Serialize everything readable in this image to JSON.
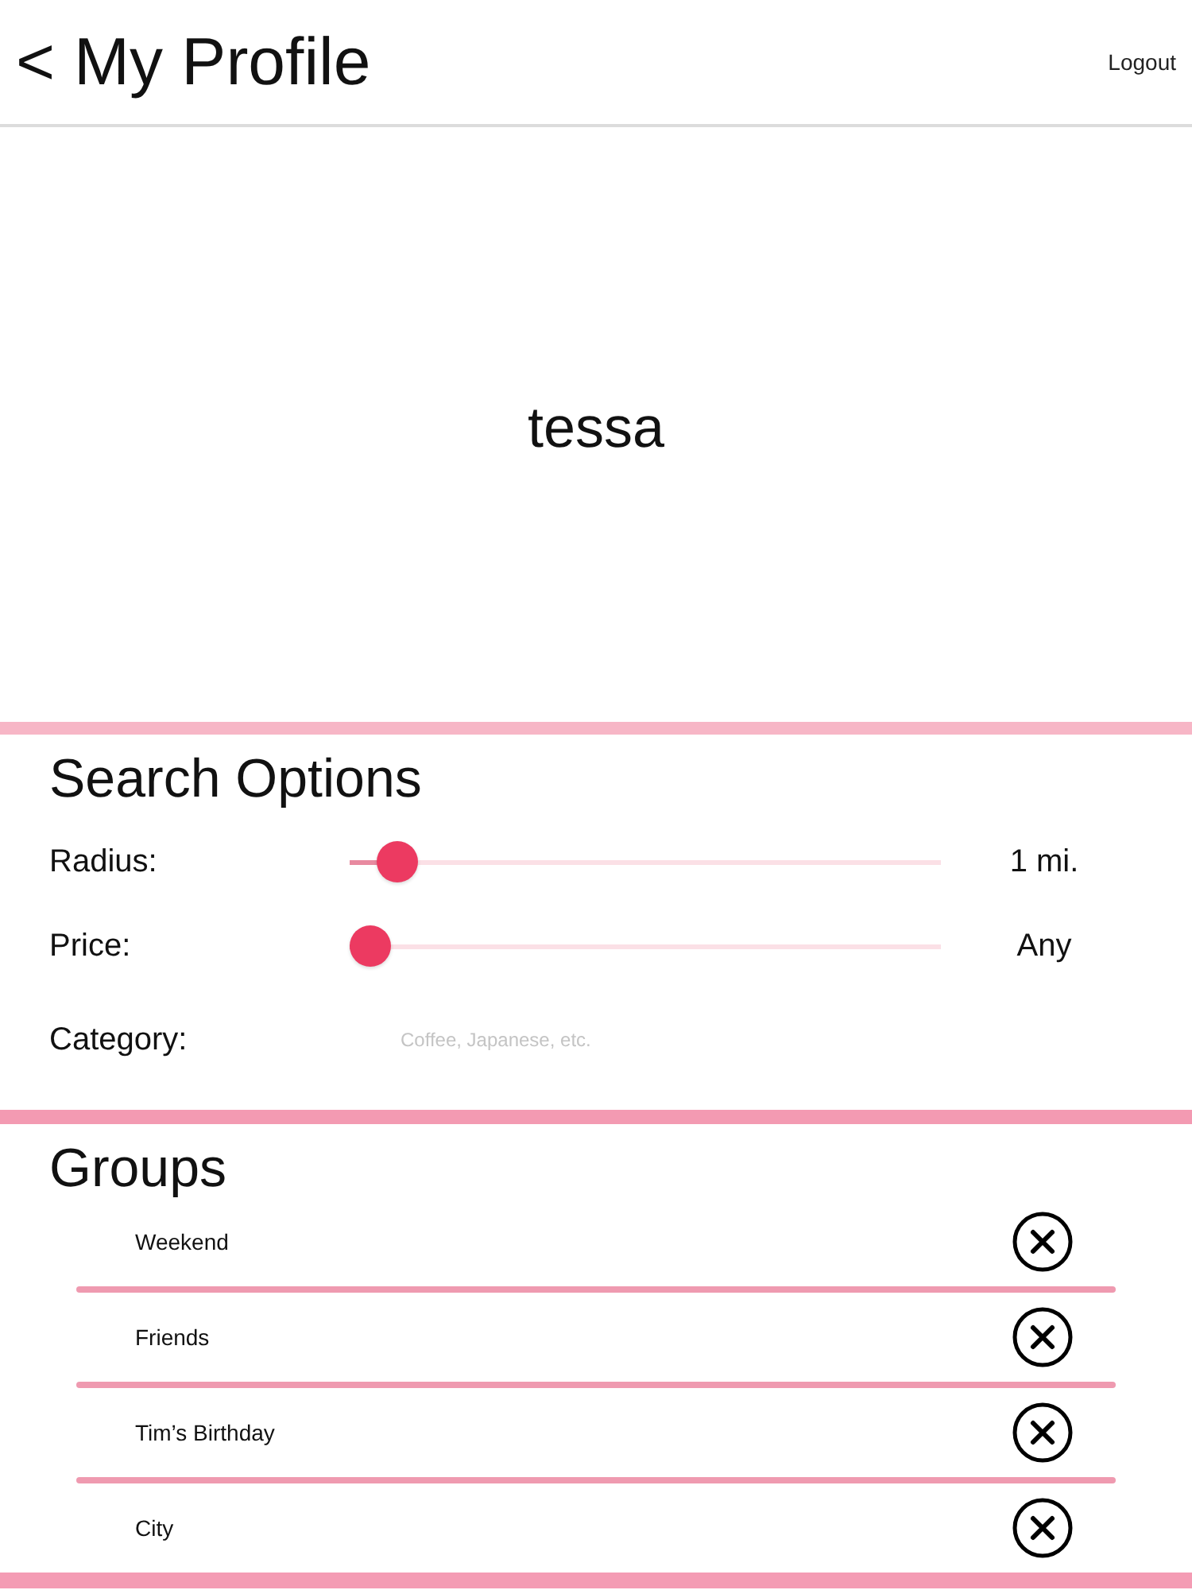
{
  "header": {
    "back": "<",
    "title": "My Profile",
    "logout": "Logout"
  },
  "profile": {
    "username": "tessa"
  },
  "search_options": {
    "title": "Search Options",
    "sliders": [
      {
        "label": "Radius:",
        "level": 0.05,
        "reading": "1 mi."
      },
      {
        "label": "Price:",
        "level": 0,
        "reading": "Any"
      }
    ],
    "category": {
      "label": "Category:",
      "placeholder": "Coffee, Japanese, etc."
    }
  },
  "groups": {
    "title": "Groups",
    "items": [
      {
        "name": "Weekend"
      },
      {
        "name": "Friends"
      },
      {
        "name": "Tim’s Birthday"
      },
      {
        "name": "City"
      }
    ]
  }
}
